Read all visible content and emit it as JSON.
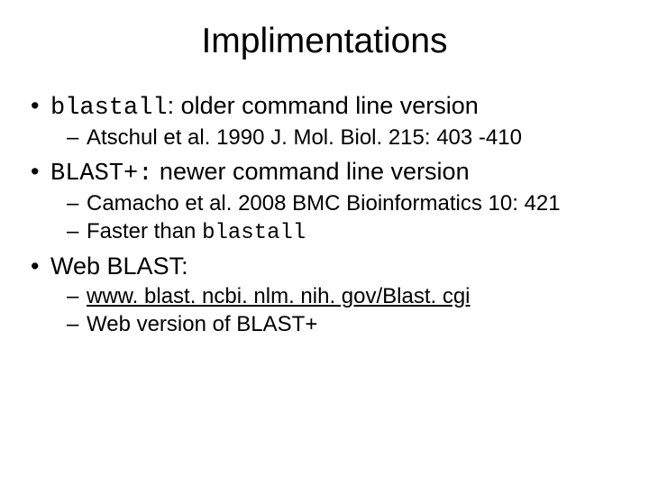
{
  "title": "Implimentations",
  "items": [
    {
      "code": "blastall",
      "rest": ": older command line version",
      "subs": [
        {
          "text": "Atschul et al. 1990 J. Mol. Biol. 215: 403 -410"
        }
      ]
    },
    {
      "code": "BLAST+:",
      "rest": "  newer command line version",
      "subs": [
        {
          "prefix": "Camacho et al. 2008 BMC Bioinformatics 10: 421"
        },
        {
          "prefix": "Faster than ",
          "code": "blastall"
        }
      ]
    },
    {
      "text": "Web BLAST:",
      "subs": [
        {
          "link": "www. blast. ncbi. nlm. nih. gov/Blast. cgi"
        },
        {
          "text": "Web version of BLAST+"
        }
      ]
    }
  ]
}
